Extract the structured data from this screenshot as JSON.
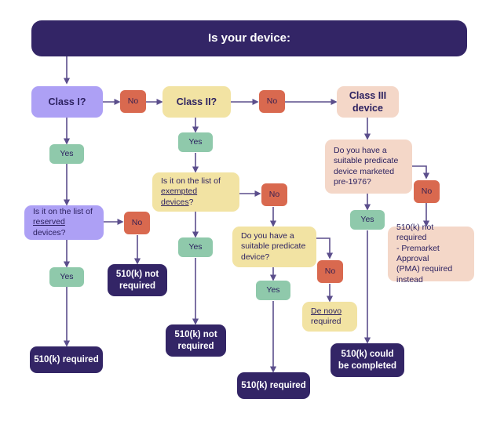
{
  "header": {
    "title": "Is your device:"
  },
  "colors": {
    "navy": "#332566",
    "purple": "#ADA0F5",
    "yellow": "#F2E3A3",
    "peach": "#F4D7C8",
    "green": "#8FC9AB",
    "orange": "#D9694F",
    "text_dark": "#2C2160",
    "connector": "#5B4E8C",
    "background": "#FFFFFF"
  },
  "nodes": {
    "class_1": "Class I?",
    "no_class1": "No",
    "class_2": "Class II?",
    "no_class2": "No",
    "class_3_line1": "Class III",
    "class_3_line2": "device",
    "yes_class1": "Yes",
    "yes_class2": "Yes",
    "reserved_q_line1": "Is it on the list of",
    "reserved_q_underlined": "reserved",
    "reserved_q_tail": " devices?",
    "no_reserved": "No",
    "exempted_q_line1": "Is it on the list of",
    "exempted_q_underlined": "exempted devices",
    "exempted_q_tail": "?",
    "no_exempted": "No",
    "predicate_c3_line1": "Do you have a",
    "predicate_c3_line2": "suitable predicate",
    "predicate_c3_line3": "device marketed",
    "predicate_c3_line4": "pre-1976?",
    "no_predicate_c3": "No",
    "yes_predicate_c3": "Yes",
    "yes_reserved": "Yes",
    "not_required_reserved_line1": "510(k) not",
    "not_required_reserved_line2": "required",
    "yes_exempted": "Yes",
    "not_required_exempted_line1": "510(k) not",
    "not_required_exempted_line2": "required",
    "predicate_c2_line1": "Do you have a",
    "predicate_c2_line2": "suitable predicate",
    "predicate_c2_line3": "device?",
    "no_predicate_c2": "No",
    "yes_predicate_c2": "Yes",
    "de_novo_underlined": "De novo",
    "de_novo_line2": "required",
    "required_reserved": "510(k) required",
    "required_predicate_c2": "510(k) required",
    "pma_line1": "510(k) not required",
    "pma_line2": "- Premarket Approval",
    "pma_line3": " (PMA) required",
    "pma_line4": "instead",
    "could_be_completed_line1": "510(k) could",
    "could_be_completed_line2": "be completed"
  }
}
